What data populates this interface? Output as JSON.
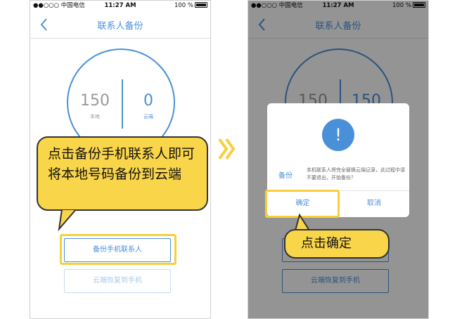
{
  "status": {
    "carrier": "●●○○○ 中国电信",
    "wifi": "wifi-icon",
    "time": "11:27 AM",
    "battery": "100 %"
  },
  "nav": {
    "title": "联系人备份",
    "back": "back-chevron-icon"
  },
  "screen1": {
    "local_count": "150",
    "local_label": "本地",
    "cloud_count": "0",
    "cloud_label": "云端",
    "backup_button": "备份手机联系人",
    "restore_button": "云端恢复到手机"
  },
  "screen2": {
    "local_count": "150",
    "cloud_count": "150",
    "restore_button": "云端恢复到手机",
    "dialog": {
      "icon": "!",
      "label": "备份",
      "message": "本机联系人将完全替换云端记录，此过程中请不要退出，开始备份？",
      "confirm": "确定",
      "cancel": "取消"
    }
  },
  "callouts": {
    "step1": "点击备份手机联系人即可将本地号码备份到云端",
    "step2": "点击确定"
  },
  "colors": {
    "accent": "#4a90d9",
    "highlight": "#f7cf3c",
    "bubble": "#f9d54a"
  }
}
